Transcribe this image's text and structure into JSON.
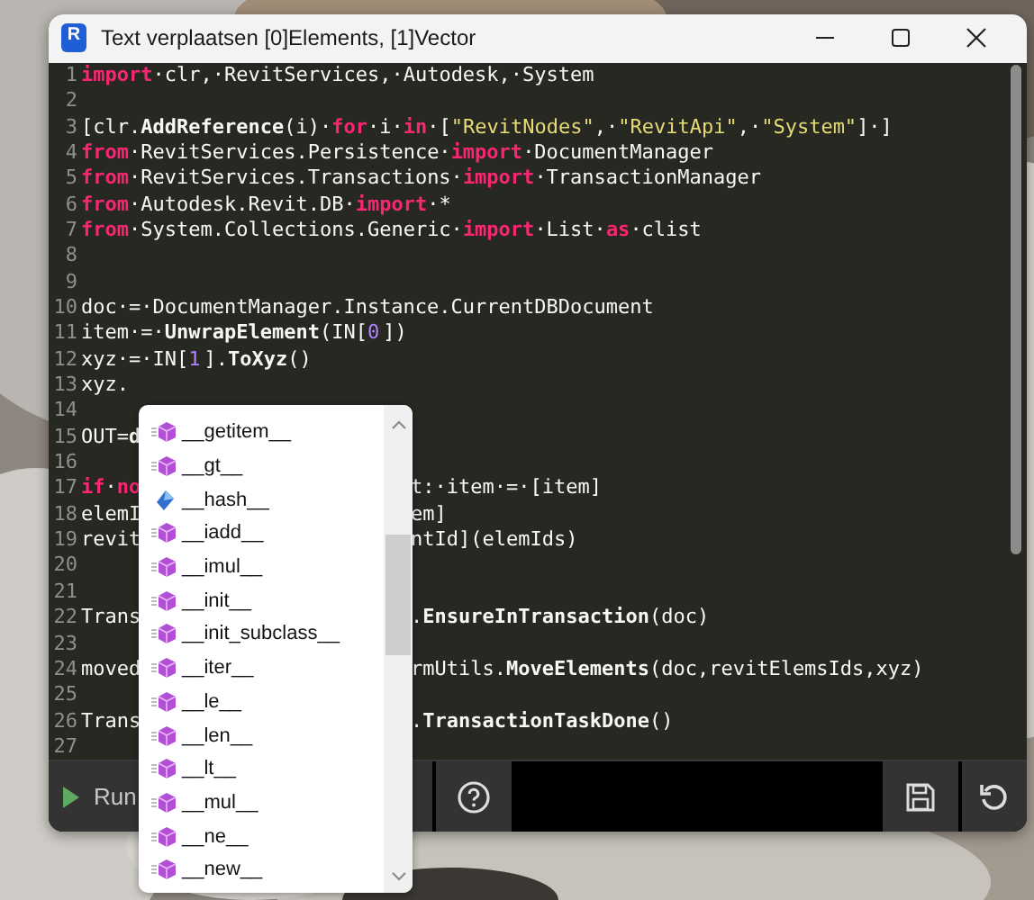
{
  "window": {
    "app_icon_letter": "R",
    "title": "Text verplaatsen [0]Elements, [1]Vector"
  },
  "editor": {
    "lines": [
      {
        "number": "1",
        "code": [
          {
            "kind": "kw",
            "t": "import"
          },
          {
            "kind": "p",
            "t": "·clr,·RevitServices,·Autodesk,·System"
          }
        ]
      },
      {
        "number": "2"
      },
      {
        "number": "3",
        "code": [
          {
            "kind": "p",
            "t": "[clr."
          },
          {
            "kind": "fn",
            "t": "AddReference"
          },
          {
            "kind": "p",
            "t": "(i)·"
          },
          {
            "kind": "kw",
            "t": "for"
          },
          {
            "kind": "p",
            "t": "·i·"
          },
          {
            "kind": "kw",
            "t": "in"
          },
          {
            "kind": "p",
            "t": "·["
          },
          {
            "kind": "str",
            "t": "\"RevitNodes\""
          },
          {
            "kind": "p",
            "t": ",·"
          },
          {
            "kind": "str",
            "t": "\"RevitApi\""
          },
          {
            "kind": "p",
            "t": ",·"
          },
          {
            "kind": "str",
            "t": "\"System\""
          },
          {
            "kind": "p",
            "t": "]·]"
          }
        ]
      },
      {
        "number": "4",
        "code": [
          {
            "kind": "kw",
            "t": "from"
          },
          {
            "kind": "p",
            "t": "·RevitServices.Persistence·"
          },
          {
            "kind": "kw",
            "t": "import"
          },
          {
            "kind": "p",
            "t": "·DocumentManager"
          }
        ]
      },
      {
        "number": "5",
        "code": [
          {
            "kind": "kw",
            "t": "from"
          },
          {
            "kind": "p",
            "t": "·RevitServices.Transactions·"
          },
          {
            "kind": "kw",
            "t": "import"
          },
          {
            "kind": "p",
            "t": "·TransactionManager"
          }
        ]
      },
      {
        "number": "6",
        "code": [
          {
            "kind": "kw",
            "t": "from"
          },
          {
            "kind": "p",
            "t": "·Autodesk.Revit.DB·"
          },
          {
            "kind": "kw",
            "t": "import"
          },
          {
            "kind": "p",
            "t": "·*"
          }
        ]
      },
      {
        "number": "7",
        "code": [
          {
            "kind": "kw",
            "t": "from"
          },
          {
            "kind": "p",
            "t": "·System.Collections.Generic·"
          },
          {
            "kind": "kw",
            "t": "import"
          },
          {
            "kind": "p",
            "t": "·List·"
          },
          {
            "kind": "kw",
            "t": "as"
          },
          {
            "kind": "p",
            "t": "·clist"
          }
        ]
      },
      {
        "number": "8"
      },
      {
        "number": "9"
      },
      {
        "number": "10",
        "code": [
          {
            "kind": "p",
            "t": "doc·=·DocumentManager.Instance.CurrentDBDocument"
          }
        ]
      },
      {
        "number": "11",
        "code": [
          {
            "kind": "p",
            "t": "item·=·"
          },
          {
            "kind": "fn",
            "t": "UnwrapElement"
          },
          {
            "kind": "p",
            "t": "(IN["
          },
          {
            "kind": "num",
            "t": "0"
          },
          {
            "kind": "p",
            "t": "])"
          }
        ]
      },
      {
        "number": "12",
        "code": [
          {
            "kind": "p",
            "t": "xyz·=·IN["
          },
          {
            "kind": "num",
            "t": "1"
          },
          {
            "kind": "p",
            "t": "]."
          },
          {
            "kind": "fn",
            "t": "ToXyz"
          },
          {
            "kind": "p",
            "t": "()"
          }
        ]
      },
      {
        "number": "13",
        "code": [
          {
            "kind": "p",
            "t": "xyz."
          }
        ]
      },
      {
        "number": "14"
      },
      {
        "number": "15",
        "code": [
          {
            "kind": "p",
            "t": "OUT="
          },
          {
            "kind": "fn",
            "t": "d"
          }
        ]
      },
      {
        "number": "16"
      },
      {
        "number": "17",
        "code": [
          {
            "kind": "kw",
            "t": "if"
          },
          {
            "kind": "p",
            "t": "·"
          },
          {
            "kind": "kw",
            "t": "no"
          }
        ],
        "code_after": [
          {
            "kind": "p",
            "t": "t:·item·=·[item]"
          }
        ]
      },
      {
        "number": "18",
        "code": [
          {
            "kind": "p",
            "t": "elemI"
          }
        ],
        "code_after": [
          {
            "kind": "p",
            "t": "em]"
          }
        ]
      },
      {
        "number": "19",
        "code": [
          {
            "kind": "p",
            "t": "revit"
          }
        ],
        "code_after": [
          {
            "kind": "p",
            "t": "ntId](elemIds)"
          }
        ]
      },
      {
        "number": "20"
      },
      {
        "number": "21"
      },
      {
        "number": "22",
        "code": [
          {
            "kind": "p",
            "t": "Trans"
          }
        ],
        "code_after": [
          {
            "kind": "p",
            "t": "."
          },
          {
            "kind": "fn",
            "t": "EnsureInTransaction"
          },
          {
            "kind": "p",
            "t": "(doc)"
          }
        ]
      },
      {
        "number": "23"
      },
      {
        "number": "24",
        "code": [
          {
            "kind": "p",
            "t": "moved"
          }
        ],
        "code_after": [
          {
            "kind": "p",
            "t": "rmUtils."
          },
          {
            "kind": "fn",
            "t": "MoveElements"
          },
          {
            "kind": "p",
            "t": "(doc,revitElemsIds,xyz)"
          }
        ]
      },
      {
        "number": "25"
      },
      {
        "number": "26",
        "code": [
          {
            "kind": "p",
            "t": "Trans"
          }
        ],
        "code_after": [
          {
            "kind": "p",
            "t": "."
          },
          {
            "kind": "fn",
            "t": "TransactionTaskDone"
          },
          {
            "kind": "p",
            "t": "()"
          }
        ]
      },
      {
        "number": "27"
      }
    ]
  },
  "toolbar": {
    "run_label": "Run"
  },
  "completion": {
    "items": [
      {
        "kind": "method",
        "label": "__getitem__"
      },
      {
        "kind": "method",
        "label": "__gt__"
      },
      {
        "kind": "field",
        "label": "__hash__"
      },
      {
        "kind": "method",
        "label": "__iadd__"
      },
      {
        "kind": "method",
        "label": "__imul__"
      },
      {
        "kind": "method",
        "label": "__init__"
      },
      {
        "kind": "method",
        "label": "__init_subclass__"
      },
      {
        "kind": "method",
        "label": "__iter__"
      },
      {
        "kind": "method",
        "label": "__le__"
      },
      {
        "kind": "method",
        "label": "__len__"
      },
      {
        "kind": "method",
        "label": "__lt__"
      },
      {
        "kind": "method",
        "label": "__mul__"
      },
      {
        "kind": "method",
        "label": "__ne__"
      },
      {
        "kind": "method",
        "label": "__new__"
      }
    ]
  }
}
